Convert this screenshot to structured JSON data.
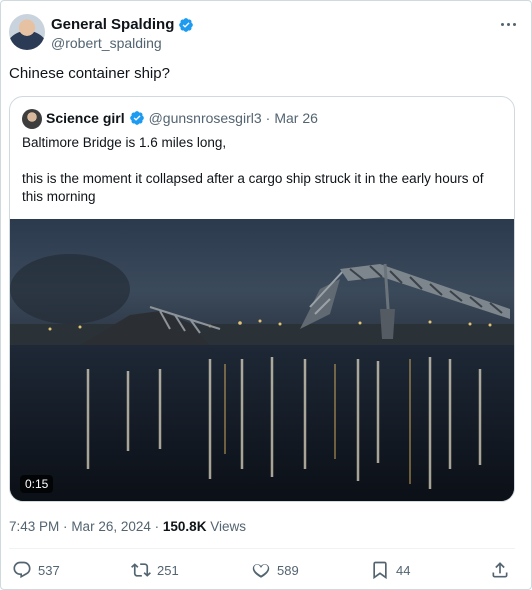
{
  "author": {
    "display_name": "General Spalding",
    "handle": "@robert_spalding",
    "verified_icon": "verified-badge-icon"
  },
  "tweet": {
    "text": "Chinese container ship?"
  },
  "quoted": {
    "display_name": "Science girl",
    "handle": "@gunsnrosesgirl3",
    "separator": "·",
    "date": "Mar 26",
    "text_line1": "Baltimore Bridge is 1.6 miles long,",
    "text_line2": "this is the moment it collapsed after a cargo ship struck it in the early hours of this morning",
    "video_duration": "0:15"
  },
  "meta": {
    "time": "7:43 PM",
    "separator": "·",
    "date": "Mar 26, 2024",
    "views_count": "150.8K",
    "views_label": "Views"
  },
  "actions": {
    "replies": "537",
    "reposts": "251",
    "likes": "589",
    "bookmarks": "44"
  },
  "colors": {
    "text": "#0f1419",
    "secondary": "#536471",
    "verified": "#1d9bf0",
    "border": "#cfd9de"
  }
}
